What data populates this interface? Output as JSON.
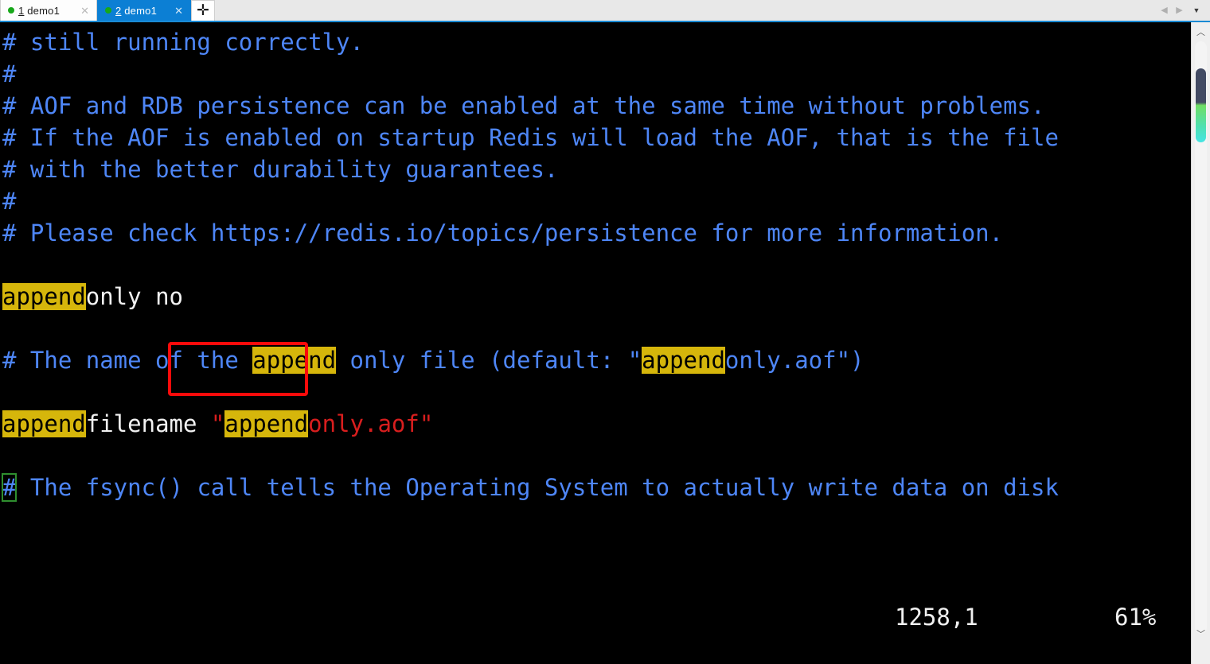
{
  "window": {
    "tabbar": {
      "tabs": [
        {
          "accelerator": "1",
          "title": " demo1",
          "status_dot": "green",
          "close_glyph": "✕",
          "active": false
        },
        {
          "accelerator": "2",
          "title": " demo1",
          "status_dot": "green",
          "close_glyph": "✕",
          "active": true
        }
      ],
      "new_tab_glyph": "✛",
      "nav_prev_glyph": "◀",
      "nav_next_glyph": "▶",
      "dropdown_glyph": "▼"
    }
  },
  "terminal": {
    "lines": [
      {
        "segments": [
          {
            "text": "# still running correctly.",
            "style": "cm"
          }
        ]
      },
      {
        "segments": [
          {
            "text": "#",
            "style": "cm"
          }
        ]
      },
      {
        "segments": [
          {
            "text": "# AOF and RDB persistence can be enabled at the same time without problems.",
            "style": "cm"
          }
        ]
      },
      {
        "segments": [
          {
            "text": "# If the AOF is enabled on startup Redis will load the AOF, that is the file",
            "style": "cm"
          }
        ]
      },
      {
        "segments": [
          {
            "text": "# with the better durability guarantees.",
            "style": "cm"
          }
        ]
      },
      {
        "segments": [
          {
            "text": "#",
            "style": "cm"
          }
        ]
      },
      {
        "segments": [
          {
            "text": "# Please check https://redis.io/topics/persistence for more information.",
            "style": "cm"
          }
        ]
      },
      {
        "segments": [
          {
            "text": "",
            "style": "cm"
          }
        ]
      },
      {
        "segments": [
          {
            "text": "append",
            "style": "hl"
          },
          {
            "text": "only ",
            "style": "key"
          },
          {
            "text": "no",
            "style": "key"
          }
        ]
      },
      {
        "segments": [
          {
            "text": "",
            "style": "cm"
          }
        ]
      },
      {
        "segments": [
          {
            "text": "# The name of the ",
            "style": "cm"
          },
          {
            "text": "append",
            "style": "hl"
          },
          {
            "text": " only file (default: \"",
            "style": "cm"
          },
          {
            "text": "append",
            "style": "hl"
          },
          {
            "text": "only.aof\")",
            "style": "cm"
          }
        ]
      },
      {
        "segments": [
          {
            "text": "",
            "style": "cm"
          }
        ]
      },
      {
        "segments": [
          {
            "text": "append",
            "style": "hl"
          },
          {
            "text": "filename ",
            "style": "key"
          },
          {
            "text": "\"",
            "style": "str"
          },
          {
            "text": "append",
            "style": "hl"
          },
          {
            "text": "only.aof\"",
            "style": "str"
          }
        ]
      },
      {
        "segments": [
          {
            "text": "",
            "style": "cm"
          }
        ]
      },
      {
        "segments": [
          {
            "text": "#",
            "style": "cm cursor-box"
          },
          {
            "text": " The fsync() call tells the Operating System to actually write data on disk",
            "style": "cm"
          }
        ]
      }
    ],
    "statusline": {
      "cursor_position": "1258,1",
      "file_percent": "61%"
    },
    "annotation": {
      "type": "rectangle",
      "color": "#fb0a0a",
      "targets_value": "no"
    },
    "colors": {
      "background": "#000000",
      "comment": "#4e86f7",
      "config_key": "#f2f2f2",
      "string_value": "#d81e1e",
      "search_highlight_bg": "#d6b60b",
      "search_highlight_fg": "#000000",
      "cursor_outline": "#2f8f2f"
    },
    "search_term": "append"
  },
  "scrollbar": {
    "up_arrow_glyph": "︿",
    "down_arrow_glyph": "﹀",
    "thumb_gradient_top": "#424a63",
    "thumb_gradient_bottom": "#45e4e4"
  }
}
